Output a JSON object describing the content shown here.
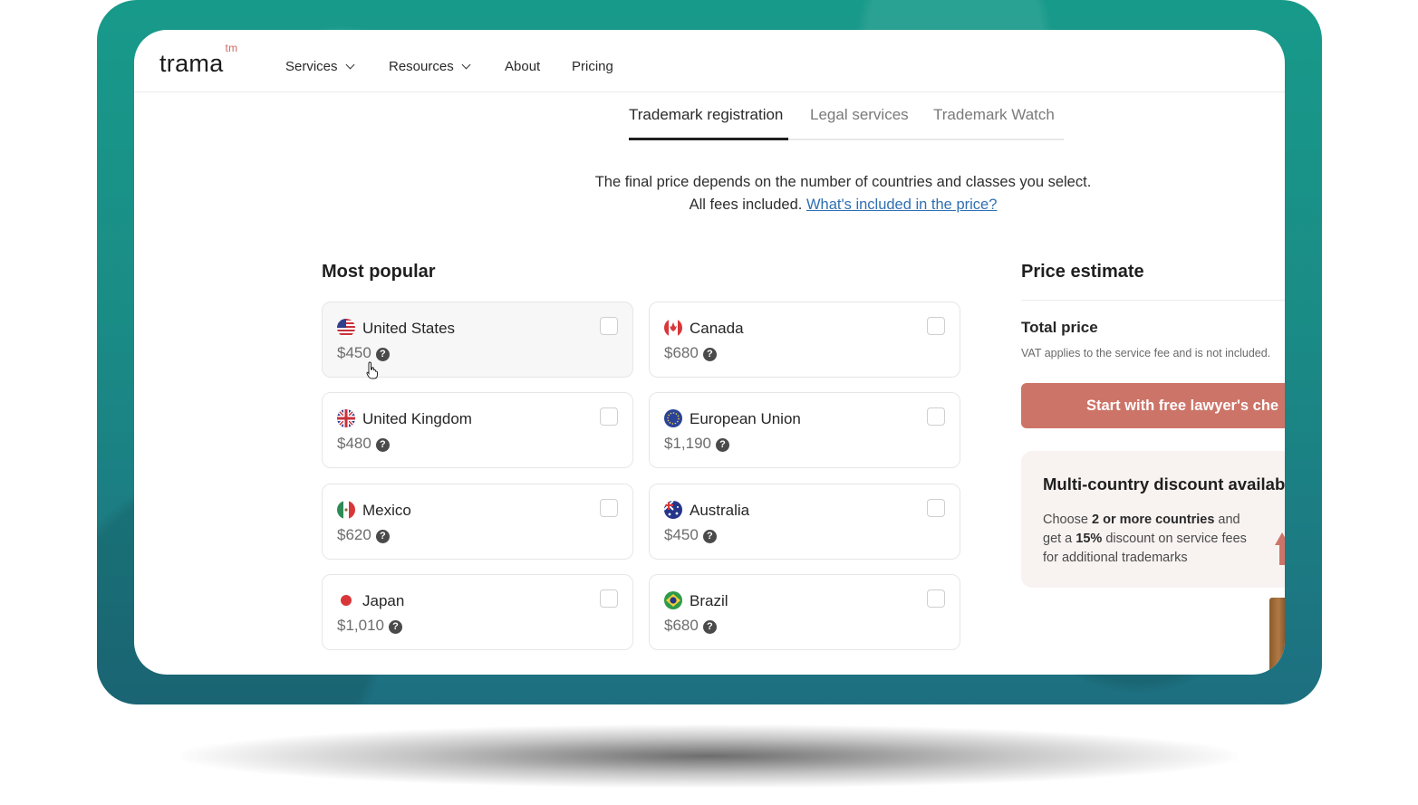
{
  "brand": {
    "name": "trama",
    "suffix": "tm"
  },
  "nav": {
    "items": [
      {
        "label": "Services",
        "dropdown": true
      },
      {
        "label": "Resources",
        "dropdown": true
      },
      {
        "label": "About",
        "dropdown": false
      },
      {
        "label": "Pricing",
        "dropdown": false
      }
    ]
  },
  "tabs": [
    {
      "label": "Trademark registration",
      "active": true
    },
    {
      "label": "Legal services",
      "active": false
    },
    {
      "label": "Trademark Watch",
      "active": false
    }
  ],
  "intro": {
    "text": "The final price depends on the number of countries and classes you select. All fees included.",
    "link": "What's included in the price?"
  },
  "popular": {
    "title": "Most popular",
    "countries": [
      {
        "name": "United States",
        "price": "$450",
        "flag": "us-flag-icon"
      },
      {
        "name": "Canada",
        "price": "$680",
        "flag": "canada-flag-icon"
      },
      {
        "name": "United Kingdom",
        "price": "$480",
        "flag": "uk-flag-icon"
      },
      {
        "name": "European Union",
        "price": "$1,190",
        "flag": "eu-flag-icon"
      },
      {
        "name": "Mexico",
        "price": "$620",
        "flag": "mexico-flag-icon"
      },
      {
        "name": "Australia",
        "price": "$450",
        "flag": "australia-flag-icon"
      },
      {
        "name": "Japan",
        "price": "$1,010",
        "flag": "japan-flag-icon"
      },
      {
        "name": "Brazil",
        "price": "$680",
        "flag": "brazil-flag-icon"
      }
    ],
    "help_glyph": "?"
  },
  "estimate": {
    "title": "Price estimate",
    "total_label": "Total price",
    "vat_note": "VAT applies to the service fee and is not included.",
    "cta_label": "Start with free lawyer's che",
    "discount": {
      "title": "Multi-country discount availab",
      "text_part1": "Choose ",
      "bold1": "2 or more countries",
      "text_part2": " and get a ",
      "bold2": "15%",
      "text_part3": " discount on service fees for additional trademarks"
    }
  },
  "colors": {
    "frame": "#1a8c86",
    "accent": "#cd7468",
    "link": "#2f6fb3",
    "discount_bg": "#f8f3f1"
  }
}
